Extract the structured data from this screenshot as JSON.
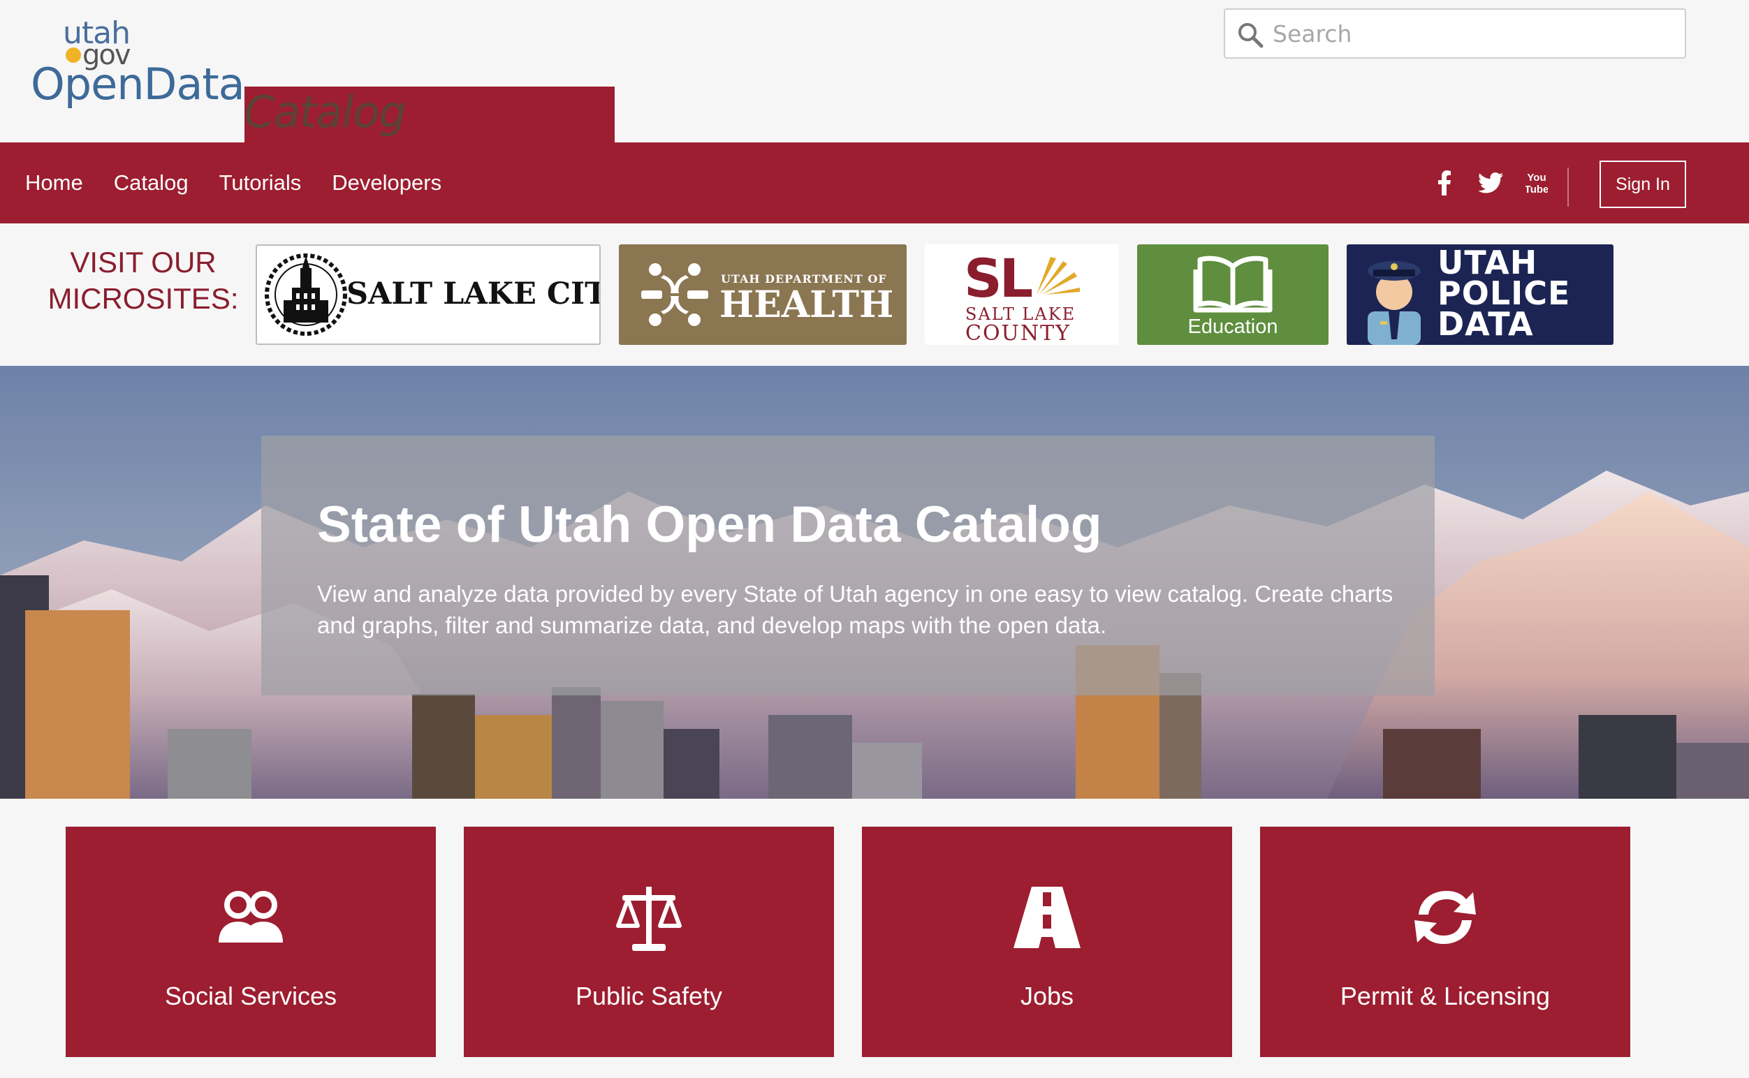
{
  "brand": {
    "top_line": "utah",
    "gov_line": "gov",
    "name_primary": "OpenData",
    "name_secondary": "Catalog"
  },
  "search": {
    "placeholder": "Search",
    "icon": "search-icon"
  },
  "nav": {
    "items": [
      {
        "label": "Home"
      },
      {
        "label": "Catalog"
      },
      {
        "label": "Tutorials"
      },
      {
        "label": "Developers"
      }
    ],
    "social": [
      {
        "name": "facebook-icon",
        "glyph": "f"
      },
      {
        "name": "twitter-icon",
        "glyph": "twitter"
      },
      {
        "name": "youtube-icon",
        "glyph": "You Tube"
      }
    ],
    "signin_label": "Sign In"
  },
  "microsites": {
    "heading_line1": "VISIT OUR",
    "heading_line2": "MICROSITES:",
    "tiles": [
      {
        "label": "SALT LAKE CITY"
      },
      {
        "label_small": "UTAH DEPARTMENT OF",
        "label": "HEALTH"
      },
      {
        "label_mark": "SL",
        "label_line1": "SALT LAKE",
        "label_line2": "COUNTY"
      },
      {
        "label": "Education"
      },
      {
        "label_line1": "UTAH",
        "label_line2": "POLICE",
        "label_line3": "DATA"
      }
    ]
  },
  "hero": {
    "title": "State of Utah Open Data Catalog",
    "description": "View and analyze data provided by every State of Utah agency in one easy to view catalog. Create charts and graphs, filter and summarize data, and develop maps with the open data."
  },
  "categories": [
    {
      "label": "Social Services",
      "icon": "people-icon"
    },
    {
      "label": "Public Safety",
      "icon": "scales-icon"
    },
    {
      "label": "Jobs",
      "icon": "road-icon"
    },
    {
      "label": "Permit & Licensing",
      "icon": "refresh-icon"
    }
  ],
  "colors": {
    "brand_red": "#9c1e30",
    "page_bg": "#f6f6f6",
    "health_tile": "#8b7652",
    "education_tile": "#5e8e3e",
    "police_tile": "#1b2453"
  }
}
